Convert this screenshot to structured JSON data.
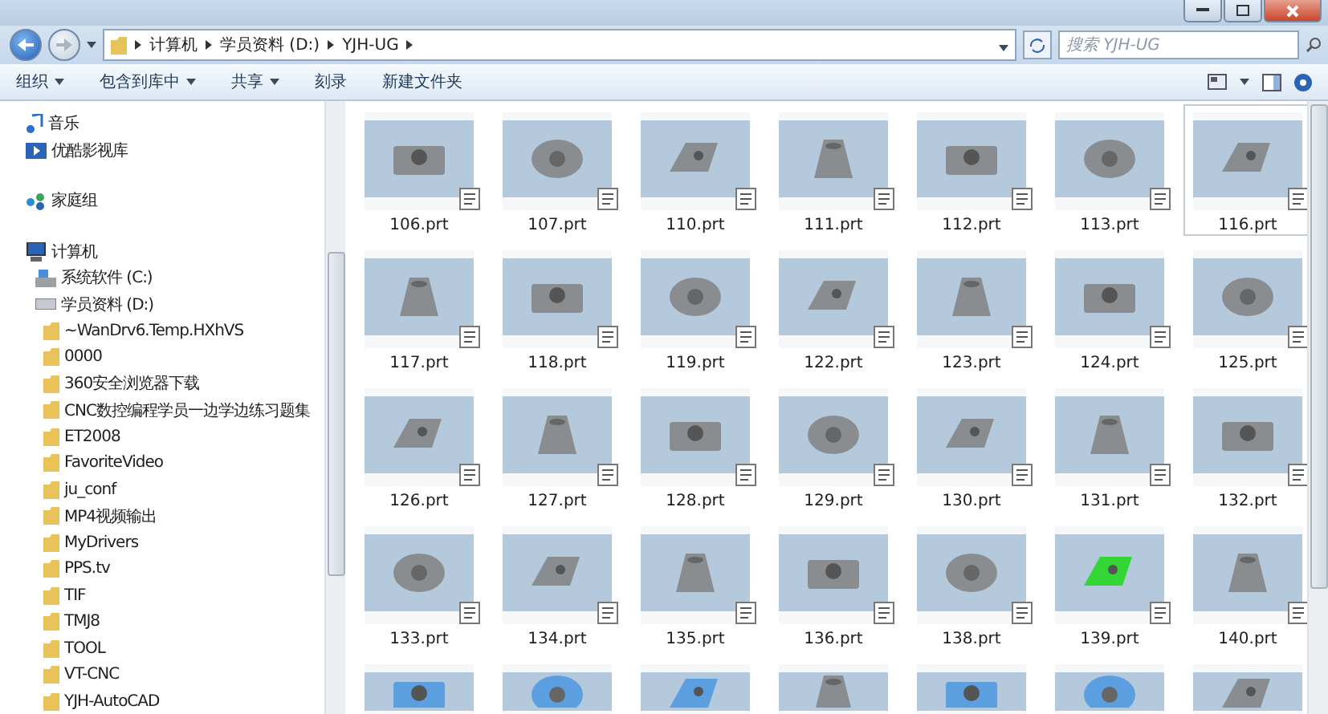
{
  "address_bar": {
    "crumbs": [
      "计算机",
      "学员资料 (D:)",
      "YJH-UG"
    ]
  },
  "search": {
    "placeholder": "搜索 YJH-UG"
  },
  "toolbar": {
    "buttons": [
      {
        "label": "组织",
        "menu": true
      },
      {
        "label": "包含到库中",
        "menu": true
      },
      {
        "label": "共享",
        "menu": true
      },
      {
        "label": "刻录",
        "menu": false
      },
      {
        "label": "新建文件夹",
        "menu": false
      }
    ]
  },
  "sidebar": {
    "sections": [
      {
        "items": [
          {
            "label": "音乐",
            "kind": "music"
          },
          {
            "label": "优酷影视库",
            "kind": "video"
          }
        ]
      },
      {
        "items": [
          {
            "label": "家庭组",
            "kind": "homegroup"
          }
        ]
      },
      {
        "items": [
          {
            "label": "计算机",
            "kind": "computer",
            "children": [
              {
                "label": "系统软件 (C:)",
                "kind": "system-drive"
              },
              {
                "label": "学员资料 (D:)",
                "kind": "drive",
                "children": [
                  {
                    "label": "~WanDrv6.Temp.HXhVS",
                    "kind": "folder"
                  },
                  {
                    "label": "0000",
                    "kind": "folder"
                  },
                  {
                    "label": "360安全浏览器下载",
                    "kind": "folder"
                  },
                  {
                    "label": "CNC数控编程学员一边学边练习题集",
                    "kind": "folder"
                  },
                  {
                    "label": "ET2008",
                    "kind": "folder"
                  },
                  {
                    "label": "FavoriteVideo",
                    "kind": "folder"
                  },
                  {
                    "label": "ju_conf",
                    "kind": "folder"
                  },
                  {
                    "label": "MP4视频输出",
                    "kind": "folder"
                  },
                  {
                    "label": "MyDrivers",
                    "kind": "folder"
                  },
                  {
                    "label": "PPS.tv",
                    "kind": "folder"
                  },
                  {
                    "label": "TIF",
                    "kind": "folder"
                  },
                  {
                    "label": "TMJ8",
                    "kind": "folder"
                  },
                  {
                    "label": "TOOL",
                    "kind": "folder"
                  },
                  {
                    "label": "VT-CNC",
                    "kind": "folder"
                  },
                  {
                    "label": "YJH-AutoCAD",
                    "kind": "folder"
                  }
                ]
              }
            ]
          }
        ]
      }
    ]
  },
  "files": [
    {
      "label": "106.prt",
      "color": "#8a8d90",
      "selected": false
    },
    {
      "label": "107.prt",
      "color": "#8a8d90",
      "selected": false
    },
    {
      "label": "110.prt",
      "color": "#8a8d90",
      "selected": false
    },
    {
      "label": "111.prt",
      "color": "#8a8d90",
      "selected": false
    },
    {
      "label": "112.prt",
      "color": "#8a8d90",
      "selected": false
    },
    {
      "label": "113.prt",
      "color": "#8a8d90",
      "selected": false
    },
    {
      "label": "116.prt",
      "color": "#8a8d90",
      "selected": true
    },
    {
      "label": "117.prt",
      "color": "#8a8d90",
      "selected": false
    },
    {
      "label": "118.prt",
      "color": "#8a8d90",
      "selected": false
    },
    {
      "label": "119.prt",
      "color": "#8a8d90",
      "selected": false
    },
    {
      "label": "122.prt",
      "color": "#8a8d90",
      "selected": false
    },
    {
      "label": "123.prt",
      "color": "#8a8d90",
      "selected": false
    },
    {
      "label": "124.prt",
      "color": "#8a8d90",
      "selected": false
    },
    {
      "label": "125.prt",
      "color": "#8a8d90",
      "selected": false
    },
    {
      "label": "126.prt",
      "color": "#8a8d90",
      "selected": false
    },
    {
      "label": "127.prt",
      "color": "#8a8d90",
      "selected": false
    },
    {
      "label": "128.prt",
      "color": "#8a8d90",
      "selected": false
    },
    {
      "label": "129.prt",
      "color": "#8a8d90",
      "selected": false
    },
    {
      "label": "130.prt",
      "color": "#8a8d90",
      "selected": false
    },
    {
      "label": "131.prt",
      "color": "#8a8d90",
      "selected": false
    },
    {
      "label": "132.prt",
      "color": "#8a8d90",
      "selected": false
    },
    {
      "label": "133.prt",
      "color": "#8a8d90",
      "selected": false
    },
    {
      "label": "134.prt",
      "color": "#8a8d90",
      "selected": false
    },
    {
      "label": "135.prt",
      "color": "#8a8d90",
      "selected": false
    },
    {
      "label": "136.prt",
      "color": "#8a8d90",
      "selected": false
    },
    {
      "label": "138.prt",
      "color": "#8a8d90",
      "selected": false
    },
    {
      "label": "139.prt",
      "color": "#33d633",
      "selected": false
    },
    {
      "label": "140.prt",
      "color": "#8a8d90",
      "selected": false
    },
    {
      "color": "#5c9fe0",
      "selected": false
    },
    {
      "color": "#5c9fe0",
      "selected": false
    },
    {
      "color": "#5c9fe0",
      "selected": false
    },
    {
      "color": "#8a8d90",
      "selected": false
    },
    {
      "color": "#5c9fe0",
      "selected": false
    },
    {
      "color": "#5c9fe0",
      "selected": false
    },
    {
      "color": "#8a8d90",
      "selected": false
    }
  ]
}
